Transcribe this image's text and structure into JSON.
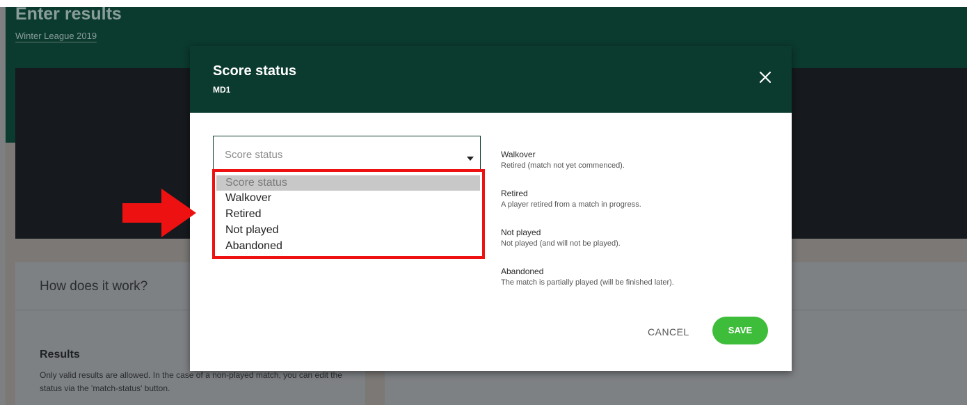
{
  "page": {
    "title": "Enter results",
    "subtitle": "Winter League 2019",
    "how_title": "How does it work?",
    "results_title": "Results",
    "results_text": "Only valid results are allowed. In the case of a non-played match, you can edit the status via the 'match-status' button."
  },
  "modal": {
    "title": "Score status",
    "subtitle": "MD1",
    "select_value": "Score status",
    "options": [
      "Score status",
      "Walkover",
      "Retired",
      "Not played",
      "Abandoned"
    ],
    "descriptions": [
      {
        "title": "Walkover",
        "text": "Retired (match not yet commenced)."
      },
      {
        "title": "Retired",
        "text": "A player retired from a match in progress."
      },
      {
        "title": "Not played",
        "text": "Not played (and will not be played)."
      },
      {
        "title": "Abandoned",
        "text": "The match is partially played (will be finished later)."
      }
    ],
    "cancel_label": "CANCEL",
    "save_label": "SAVE"
  },
  "colors": {
    "header": "#0b3a2e",
    "save": "#3dbd39",
    "highlight": "#ee1111"
  }
}
